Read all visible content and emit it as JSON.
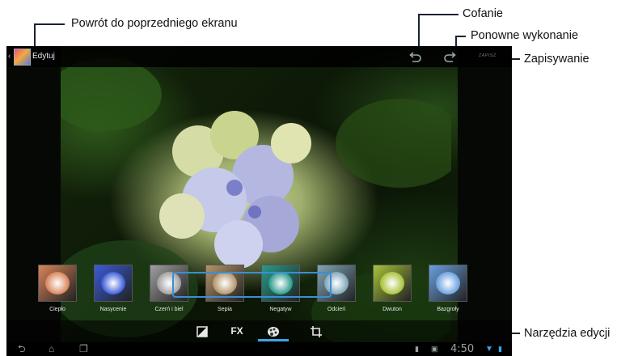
{
  "callouts": {
    "back": "Powrót do poprzedniego ekranu",
    "undo": "Cofanie",
    "redo": "Ponowne wykonanie",
    "save": "Zapisywanie",
    "tools": "Narzędzia edycji"
  },
  "action_bar": {
    "title": "Edytuj",
    "back_icon": "chevron-left",
    "undo_icon": "undo-arrow",
    "redo_icon": "redo-arrow",
    "save_label": "ZAPISZ"
  },
  "filters": [
    {
      "label": "Ciepło",
      "color": "#d8845a"
    },
    {
      "label": "Nasycenie",
      "color": "#3b5bd8"
    },
    {
      "label": "Czerń i biel",
      "color": "#a0a0a0"
    },
    {
      "label": "Sepia",
      "color": "#b3946a"
    },
    {
      "label": "Negatyw",
      "color": "#2a9a8a"
    },
    {
      "label": "Odcień",
      "color": "#7fa6b8"
    },
    {
      "label": "Dwuton",
      "color": "#a8c23a"
    },
    {
      "label": "Bazgroły",
      "color": "#6aa0e0"
    }
  ],
  "toolbar": {
    "exposure_icon": "contrast-half",
    "fx_label": "FX",
    "colors_icon": "palette",
    "crop_icon": "crop"
  },
  "status_bar": {
    "time": "4:50",
    "nav_icons": [
      "back-icon",
      "home-icon",
      "recent-apps-icon"
    ]
  },
  "colors": {
    "accent": "#3aa5e8",
    "highlight_border": "#3a8fd6"
  }
}
